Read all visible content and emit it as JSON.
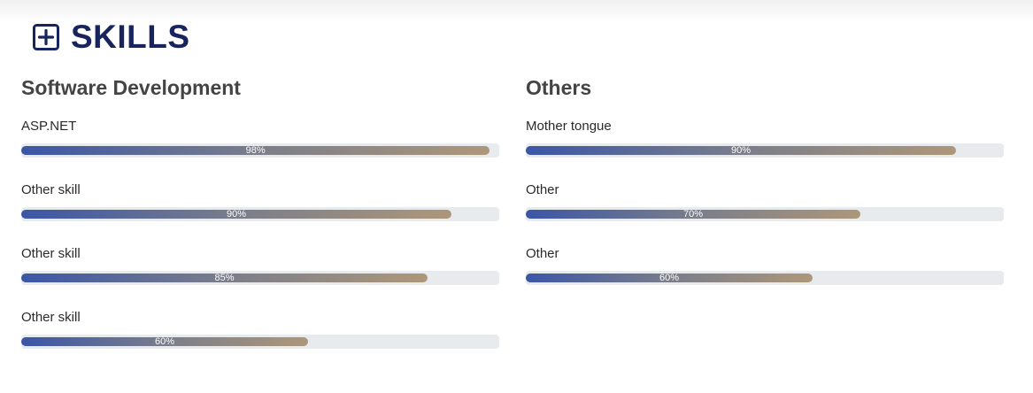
{
  "section": {
    "title": "SKILLS",
    "icon": "plus-square-icon",
    "title_color": "#17255c"
  },
  "colors": {
    "bar_start": "#3b56a6",
    "bar_mid": "#7a7d8a",
    "bar_end": "#ad977a",
    "track": "#e8ebee"
  },
  "columns": [
    {
      "title": "Software Development",
      "skills": [
        {
          "label": "ASP.NET",
          "value": "98%",
          "level": 98
        },
        {
          "label": "Other skill",
          "value": "90%",
          "level": 90
        },
        {
          "label": "Other skill",
          "value": "85%",
          "level": 85
        },
        {
          "label": "Other skill",
          "value": "60%",
          "level": 60
        }
      ]
    },
    {
      "title": "Others",
      "skills": [
        {
          "label": "Mother tongue",
          "value": "90%",
          "level": 90
        },
        {
          "label": "Other",
          "value": "70%",
          "level": 70
        },
        {
          "label": "Other",
          "value": "60%",
          "level": 60
        }
      ]
    }
  ]
}
